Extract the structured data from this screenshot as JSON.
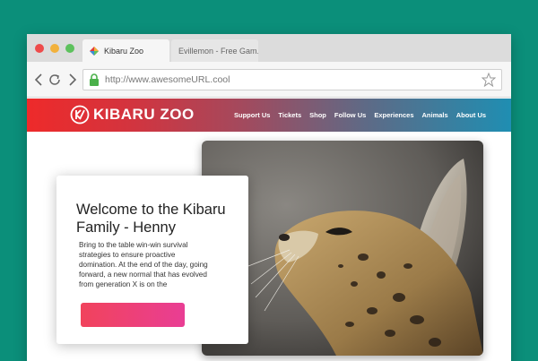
{
  "browser": {
    "tabs": [
      {
        "title": "Kibaru Zoo",
        "active": true
      },
      {
        "title": "Evillemon - Free Gam...",
        "active": false
      }
    ],
    "url": "http://www.awesomeURL.cool"
  },
  "site": {
    "logo_text": "KIBARU ZOO",
    "nav": [
      "Support Us",
      "Tickets",
      "Shop",
      "Follow Us",
      "Experiences",
      "Animals",
      "About Us"
    ],
    "hero": {
      "title": "Welcome to the Kibaru Family - Henny",
      "body": "Bring to the table win-win survival strategies to ensure proactive domination. At the end of the day, going forward, a new normal that has evolved from generation X is on the",
      "cta_label": ""
    }
  },
  "colors": {
    "background": "#0b8f7a",
    "nav_gradient_start": "#ee2a2a",
    "nav_gradient_end": "#1f8eb2",
    "cta_gradient_start": "#f1435c",
    "cta_gradient_end": "#e93e94"
  },
  "icons": {
    "window_controls": [
      "close-icon",
      "minimize-icon",
      "maximize-icon"
    ],
    "nav_buttons": [
      "back-arrow-icon",
      "reload-icon",
      "forward-arrow-icon"
    ],
    "secure": "lock-icon",
    "bookmark": "star-icon"
  }
}
